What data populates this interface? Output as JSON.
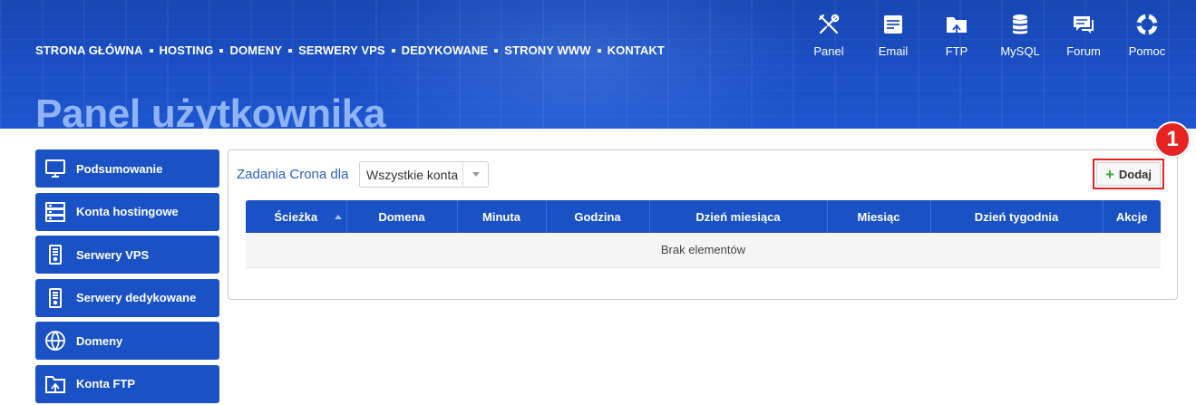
{
  "nav": {
    "items": [
      "STRONA GŁÓWNA",
      "HOSTING",
      "DOMENY",
      "SERWERY VPS",
      "DEDYKOWANE",
      "STRONY WWW",
      "KONTAKT"
    ]
  },
  "quick_links": [
    {
      "label": "Panel",
      "icon": "tools-icon"
    },
    {
      "label": "Email",
      "icon": "email-icon"
    },
    {
      "label": "FTP",
      "icon": "folder-icon"
    },
    {
      "label": "MySQL",
      "icon": "database-icon"
    },
    {
      "label": "Forum",
      "icon": "chat-icon"
    },
    {
      "label": "Pomoc",
      "icon": "lifebuoy-icon"
    }
  ],
  "page": {
    "title": "Panel użytkownika"
  },
  "sidebar": {
    "items": [
      {
        "label": "Podsumowanie",
        "icon": "monitor-icon"
      },
      {
        "label": "Konta hostingowe",
        "icon": "server-stack-icon"
      },
      {
        "label": "Serwery VPS",
        "icon": "server-icon"
      },
      {
        "label": "Serwery dedykowane",
        "icon": "server-icon"
      },
      {
        "label": "Domeny",
        "icon": "www-globe-icon"
      },
      {
        "label": "Konta FTP",
        "icon": "folder-upload-icon"
      }
    ]
  },
  "cron": {
    "label": "Zadania Crona dla",
    "account_select": "Wszystkie konta",
    "add_label": "Dodaj",
    "step_badge": "1",
    "columns": [
      "Ścieżka",
      "Domena",
      "Minuta",
      "Godzina",
      "Dzień miesiąca",
      "Miesiąc",
      "Dzień tygodnia",
      "Akcje"
    ],
    "empty_text": "Brak elementów"
  },
  "colors": {
    "brand_blue": "#1a52c5",
    "highlight_red": "#e52421",
    "add_plus_green": "#3aa43a"
  }
}
